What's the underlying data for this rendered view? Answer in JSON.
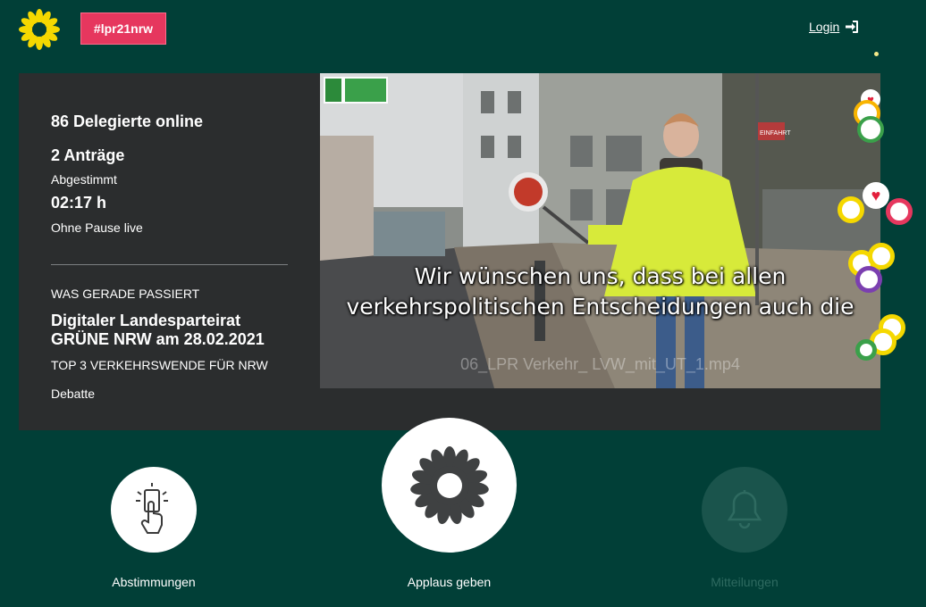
{
  "header": {
    "hashtag": "#lpr21nrw",
    "login_label": "Login"
  },
  "stats": {
    "delegates": "86 Delegierte online",
    "motions": "2 Anträge",
    "motions_status": "Abgestimmt",
    "duration": "02:17 h",
    "duration_status": "Ohne Pause live"
  },
  "current": {
    "heading": "WAS GERADE PASSIERT",
    "event_title": "Digitaler Landesparteirat GRÜNE NRW am 28.02.2021",
    "agenda_item": "TOP 3 VERKEHRSWENDE FÜR NRW",
    "phase": "Debatte"
  },
  "video": {
    "subtitle_line1": "Wir wünschen uns, dass bei allen",
    "subtitle_line2": "verkehrspolitischen Entscheidungen auch die",
    "filename": "06_LPR Verkehr_ LVW_mit_UT_1.mp4",
    "sign_text": "EINFAHRT"
  },
  "actions": {
    "vote_label": "Abstimmungen",
    "applause_label": "Applaus geben",
    "messages_label": "Mitteilungen"
  },
  "colors": {
    "background": "#013f37",
    "panel": "#2b2d2e",
    "hashtag": "#e6375e",
    "sunflower": "#f5d800",
    "disabled_circle": "#1a544c"
  },
  "icons": {
    "logo": "sunflower-logo-icon",
    "login": "sign-in-icon",
    "vote": "hand-vote-icon",
    "applause": "sunflower-icon",
    "messages": "bell-icon"
  }
}
